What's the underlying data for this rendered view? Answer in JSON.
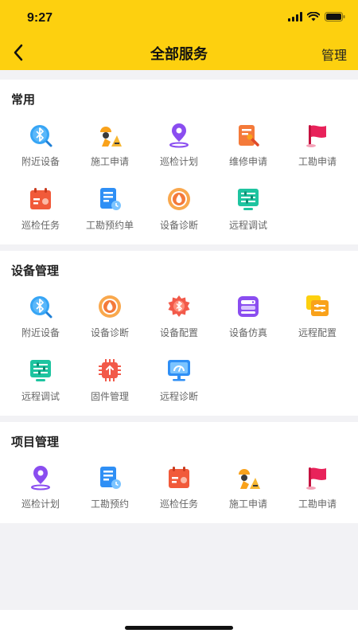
{
  "status": {
    "time": "9:27"
  },
  "nav": {
    "title": "全部服务",
    "manage": "管理"
  },
  "sections": [
    {
      "title": "常用",
      "items": [
        {
          "label": "附近设备",
          "icon": "bluetooth-search-icon"
        },
        {
          "label": "施工申请",
          "icon": "construction-worker-icon"
        },
        {
          "label": "巡检计划",
          "icon": "location-pin-icon"
        },
        {
          "label": "维修申请",
          "icon": "repair-form-icon"
        },
        {
          "label": "工勘申请",
          "icon": "flag-icon"
        },
        {
          "label": "巡检任务",
          "icon": "calendar-task-icon"
        },
        {
          "label": "工勘预约单",
          "icon": "document-clock-icon"
        },
        {
          "label": "设备诊断",
          "icon": "diagnosis-drop-icon"
        },
        {
          "label": "远程调试",
          "icon": "remote-sliders-icon"
        }
      ]
    },
    {
      "title": "设备管理",
      "items": [
        {
          "label": "附近设备",
          "icon": "bluetooth-search-icon"
        },
        {
          "label": "设备诊断",
          "icon": "diagnosis-drop-icon"
        },
        {
          "label": "设备配置",
          "icon": "gear-bluetooth-icon"
        },
        {
          "label": "设备仿真",
          "icon": "server-stack-icon"
        },
        {
          "label": "远程配置",
          "icon": "remote-config-icon"
        },
        {
          "label": "远程调试",
          "icon": "remote-sliders-icon"
        },
        {
          "label": "固件管理",
          "icon": "chip-upload-icon"
        },
        {
          "label": "远程诊断",
          "icon": "monitor-gauge-icon"
        }
      ]
    },
    {
      "title": "项目管理",
      "items": [
        {
          "label": "巡检计划",
          "icon": "location-pin-icon"
        },
        {
          "label": "工勘预约",
          "icon": "document-clock-icon"
        },
        {
          "label": "巡检任务",
          "icon": "calendar-task-icon"
        },
        {
          "label": "施工申请",
          "icon": "construction-worker-icon"
        },
        {
          "label": "工勘申请",
          "icon": "flag-icon"
        }
      ]
    }
  ],
  "colors": {
    "header": "#fdd00f",
    "background": "#f2f2f5"
  }
}
